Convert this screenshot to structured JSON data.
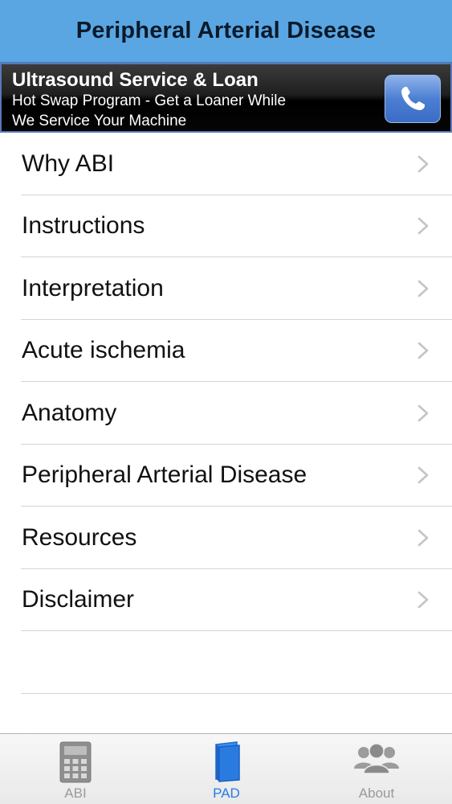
{
  "navbar": {
    "title": "Peripheral Arterial Disease"
  },
  "ad": {
    "title": "Ultrasound Service & Loan",
    "line1": "Hot Swap Program - Get a Loaner While",
    "line2": "We Service Your Machine",
    "call_icon": "phone-icon",
    "accent": "#5a78b8"
  },
  "menu": {
    "items": [
      {
        "label": "Why ABI"
      },
      {
        "label": "Instructions"
      },
      {
        "label": "Interpretation"
      },
      {
        "label": "Acute ischemia"
      },
      {
        "label": "Anatomy"
      },
      {
        "label": "Peripheral Arterial Disease"
      },
      {
        "label": "Resources"
      },
      {
        "label": "Disclaimer"
      }
    ]
  },
  "tabbar": {
    "tabs": [
      {
        "label": "ABI",
        "icon": "calculator-icon",
        "active": false
      },
      {
        "label": "PAD",
        "icon": "book-icon",
        "active": true
      },
      {
        "label": "About",
        "icon": "people-icon",
        "active": false
      }
    ],
    "active_color": "#2a7be0",
    "inactive_color": "#9a9a9a"
  },
  "colors": {
    "navbar": "#5aa6e3"
  }
}
